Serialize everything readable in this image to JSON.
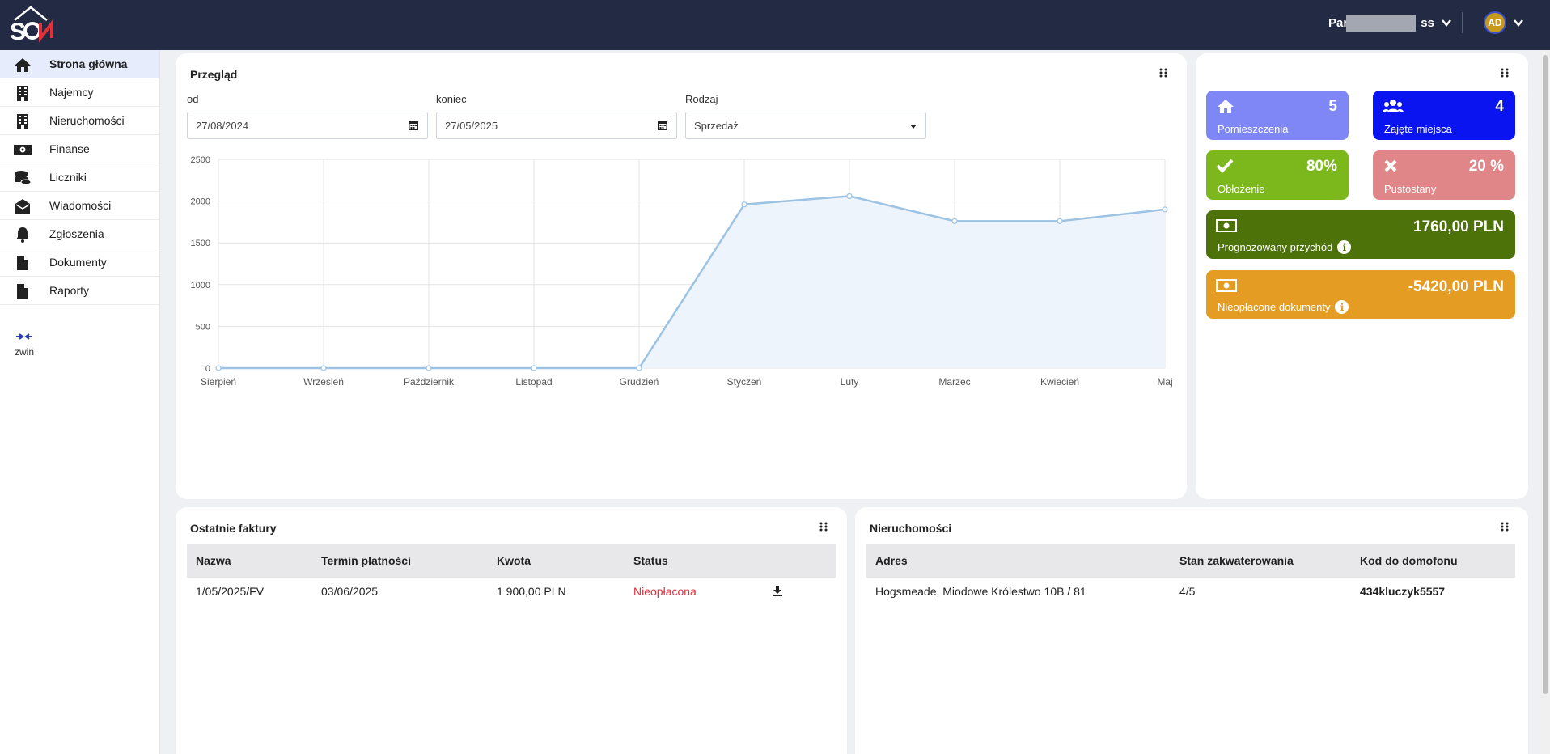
{
  "header": {
    "logo_text": "SON",
    "user_name_start": "Par",
    "user_name_end": "ss",
    "avatar_initials": "AD"
  },
  "sidebar": {
    "items": [
      {
        "label": "Strona główna",
        "icon": "home-icon",
        "active": true
      },
      {
        "label": "Najemcy",
        "icon": "building-icon",
        "active": false
      },
      {
        "label": "Nieruchomości",
        "icon": "building-icon",
        "active": false
      },
      {
        "label": "Finanse",
        "icon": "money-icon",
        "active": false
      },
      {
        "label": "Liczniki",
        "icon": "coins-icon",
        "active": false
      },
      {
        "label": "Wiadomości",
        "icon": "envelope-open-icon",
        "active": false
      },
      {
        "label": "Zgłoszenia",
        "icon": "bell-icon",
        "active": false
      },
      {
        "label": "Dokumenty",
        "icon": "file-icon",
        "active": false
      },
      {
        "label": "Raporty",
        "icon": "file-icon",
        "active": false
      }
    ],
    "collapse_label": "zwiń"
  },
  "overview": {
    "title": "Przegląd",
    "from_label": "od",
    "from_value": "27/08/2024",
    "to_label": "koniec",
    "to_value": "27/05/2025",
    "type_label": "Rodzaj",
    "type_value": "Sprzedaż"
  },
  "chart_data": {
    "type": "area",
    "categories": [
      "Sierpień",
      "Wrzesień",
      "Październik",
      "Listopad",
      "Grudzień",
      "Styczeń",
      "Luty",
      "Marzec",
      "Kwiecień",
      "Maj"
    ],
    "series": [
      {
        "values": [
          0,
          0,
          0,
          0,
          0,
          1960,
          2060,
          1760,
          1760,
          1900
        ]
      }
    ],
    "ylim": [
      0,
      2500
    ],
    "yticks": [
      0,
      500,
      1000,
      1500,
      2000,
      2500
    ],
    "grid": true,
    "line_color": "#9cc3e4",
    "fill_color": "#eef4fc"
  },
  "stats": {
    "rooms": {
      "value": "5",
      "label": "Pomieszczenia",
      "color": "#7f86f6"
    },
    "occupied": {
      "value": "4",
      "label": "Zajęte miejsca",
      "color": "#0a14f0"
    },
    "occupancy": {
      "value": "80%",
      "label": "Obłożenie",
      "color": "#7cb81c"
    },
    "vacancy": {
      "value": "20 %",
      "label": "Pustostany",
      "color": "#e08588"
    },
    "forecast": {
      "value": "1760,00 PLN",
      "label": "Prognozowany przychód",
      "color": "#4d720a"
    },
    "unpaid": {
      "value": "-5420,00 PLN",
      "label": "Nieopłacone dokumenty",
      "color": "#e59c22"
    }
  },
  "invoices": {
    "title": "Ostatnie faktury",
    "columns": [
      "Nazwa",
      "Termin płatności",
      "Kwota",
      "Status"
    ],
    "rows": [
      {
        "name": "1/05/2025/FV",
        "due": "03/06/2025",
        "amount": "1 900,00 PLN",
        "status": "Nieopłacona"
      }
    ]
  },
  "properties": {
    "title": "Nieruchomości",
    "columns": [
      "Adres",
      "Stan zakwaterowania",
      "Kod do domofonu"
    ],
    "rows": [
      {
        "address": "Hogsmeade, Miodowe Królestwo 10B / 81",
        "occupancy": "4/5",
        "code": "434kluczyk5557"
      }
    ]
  }
}
